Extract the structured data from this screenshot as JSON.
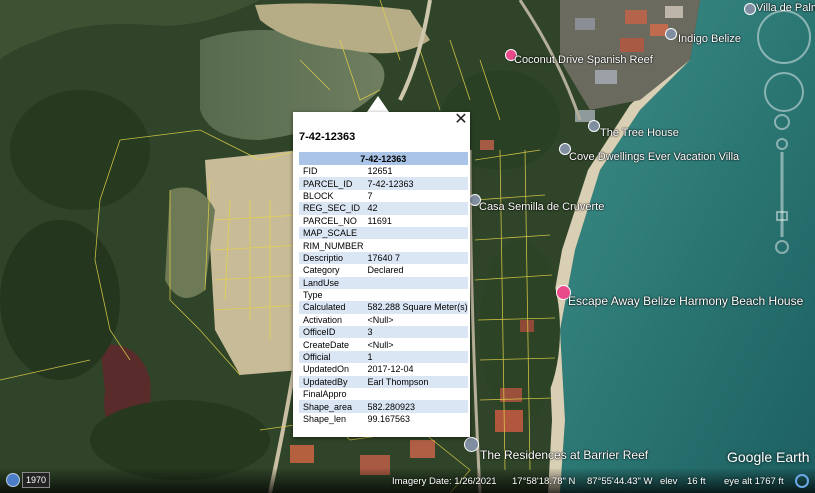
{
  "popup": {
    "title": "7-42-12363",
    "header": "7-42-12363",
    "close": "✕",
    "rows": [
      {
        "key": "FID",
        "value": "12651"
      },
      {
        "key": "PARCEL_ID",
        "value": "7-42-12363"
      },
      {
        "key": "BLOCK",
        "value": "7"
      },
      {
        "key": "REG_SEC_ID",
        "value": "42"
      },
      {
        "key": "PARCEL_NO",
        "value": "11691"
      },
      {
        "key": "MAP_SCALE",
        "value": ""
      },
      {
        "key": "RIM_NUMBER",
        "value": ""
      },
      {
        "key": "Descriptio",
        "value": "17640 7"
      },
      {
        "key": "Category",
        "value": "Declared"
      },
      {
        "key": "LandUse",
        "value": ""
      },
      {
        "key": "Type",
        "value": ""
      },
      {
        "key": "Calculated",
        "value": "582.288 Square Meter(s)"
      },
      {
        "key": "Activation",
        "value": "<Null>"
      },
      {
        "key": "OfficeID",
        "value": "3"
      },
      {
        "key": "CreateDate",
        "value": "<Null>"
      },
      {
        "key": "Official",
        "value": "1"
      },
      {
        "key": "UpdatedOn",
        "value": "2017-12-04"
      },
      {
        "key": "UpdatedBy",
        "value": "Earl Thompson"
      },
      {
        "key": "FinalAppro",
        "value": ""
      },
      {
        "key": "Shape_area",
        "value": "582.280923"
      },
      {
        "key": "Shape_len",
        "value": "99.167563"
      }
    ]
  },
  "places": {
    "villa_de_palm": "Villa de Palm",
    "indigo_belize": "Indigo Belize",
    "coconut_drive": "Coconut Drive Spanish Reef",
    "tree_house": "The Tree House",
    "cove_dwellings": "Cove Dwellings Ever Vacation Villa",
    "casa_semilla": "Casa Semilla de Cruverte",
    "escape_away": "Escape Away Belize Harmony Beach House",
    "residences": "The Residences at Barrier Reef"
  },
  "status": {
    "year": "1970",
    "imagery_date": "Imagery Date: 1/26/2021",
    "lat": "17°58'18.78\" N",
    "lon": "87°55'44.43\" W",
    "elev_label": "elev",
    "elev_value": "16 ft",
    "eye_alt": "eye alt  1767 ft"
  },
  "branding": {
    "logo": "Google Earth"
  },
  "icons": {
    "close": "close-icon",
    "compass": "compass-icon",
    "look": "look-joystick-icon",
    "zoom": "zoom-slider-icon",
    "historic": "historic-imagery-icon",
    "streaming": "streaming-status-icon",
    "pin": "place-pin-icon"
  }
}
